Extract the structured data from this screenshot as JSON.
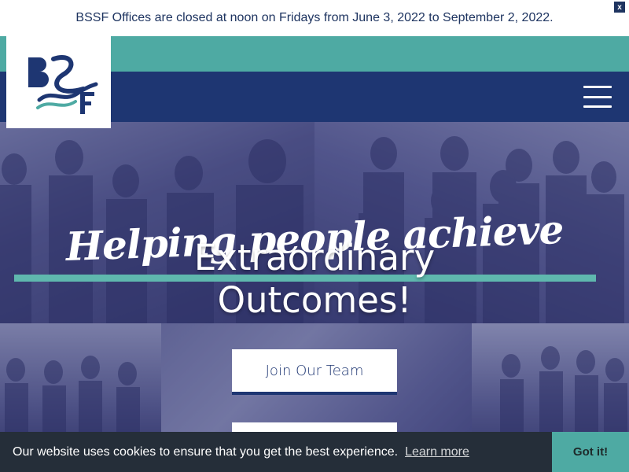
{
  "announcement": {
    "text": "BSSF Offices are closed at noon on Fridays from June 3, 2022 to September 2, 2022.",
    "close_label": "x"
  },
  "header": {
    "logo_icon": "bssf-logo",
    "menu_icon": "hamburger-menu-icon"
  },
  "hero": {
    "script_text": "Helping people achieve",
    "headline_line1": "Extraordinary",
    "headline_line2": "Outcomes!",
    "buttons": [
      {
        "label": "Join Our Team"
      },
      {
        "label": ""
      }
    ]
  },
  "cookie_banner": {
    "message": "Our website uses cookies to ensure that you get the best experience.",
    "link_label": "Learn more",
    "accept_label": "Got it!"
  },
  "colors": {
    "navy": "#1e3672",
    "teal": "#4eaaa3",
    "cookie_bg": "#252e39",
    "hero_tint": "#3c4078"
  }
}
